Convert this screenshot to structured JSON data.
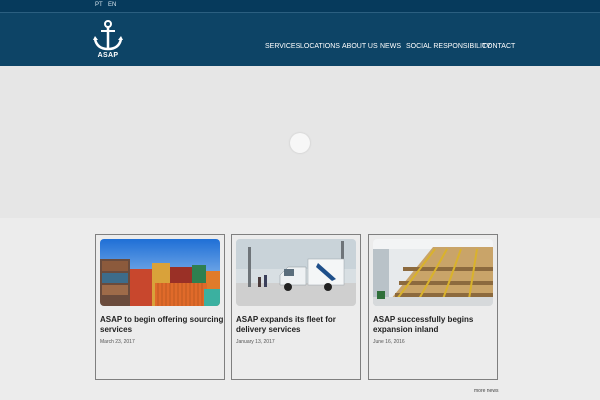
{
  "languages": [
    "PT",
    "EN"
  ],
  "brand": {
    "name": "ASAP"
  },
  "nav": [
    "SERVICES",
    "LOCATIONS",
    "ABOUT US",
    "NEWS",
    "SOCIAL RESPONSIBILITY",
    "CONTACT"
  ],
  "news": [
    {
      "title": "ASAP to begin offering sourcing services",
      "date": "March 23, 2017",
      "image": "shipping-containers-image"
    },
    {
      "title": "ASAP expands its fleet for delivery services",
      "date": "January 13, 2017",
      "image": "delivery-truck-image"
    },
    {
      "title": "ASAP successfully begins expansion inland",
      "date": "June 16, 2016",
      "image": "warehouse-shelves-image"
    }
  ],
  "more_news": "more news",
  "colors": {
    "topbar": "#063a5c",
    "header": "#0d4466",
    "hero": "#e6e6e6",
    "page": "#ececec"
  }
}
